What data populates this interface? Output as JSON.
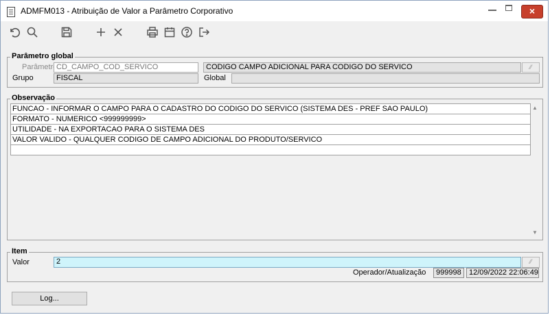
{
  "window": {
    "title": "ADMFM013 - Atribuição de Valor a Parâmetro Corporativo",
    "close_glyph": "×"
  },
  "toolbar": {
    "icons": [
      "undo-icon",
      "search-icon",
      "save-icon",
      "add-icon",
      "delete-icon",
      "print-icon",
      "calendar-icon",
      "help-icon",
      "exit-icon"
    ]
  },
  "parametro_global": {
    "legend": "Parâmetro global",
    "parametro_label": "Parâmetro",
    "parametro_value": "CD_CAMPO_COD_SERVICO",
    "descricao_value": "CODIGO CAMPO ADICIONAL PARA CODIGO DO SERVICO",
    "grupo_label": "Grupo",
    "grupo_value": "FISCAL",
    "global_label": "Global",
    "global_value": ""
  },
  "observacao": {
    "legend": "Observação",
    "lines": [
      "FUNCAO - INFORMAR O CAMPO PARA O CADASTRO DO CODIGO DO SERVICO (SISTEMA DES - PREF SAO PAULO)",
      "FORMATO - NUMERICO <999999999>",
      "UTILIDADE - NA EXPORTACAO PARA O SISTEMA DES",
      "VALOR VALIDO - QUALQUER CODIGO DE CAMPO ADICIONAL DO PRODUTO/SERVICO",
      ""
    ]
  },
  "item": {
    "legend": "Item",
    "valor_label": "Valor",
    "valor_value": "2",
    "operador_label": "Operador/Atualização",
    "operador_value": "999998",
    "atualizacao_value": "12/09/2022 22:06:49"
  },
  "footer": {
    "log_button": "Log..."
  }
}
